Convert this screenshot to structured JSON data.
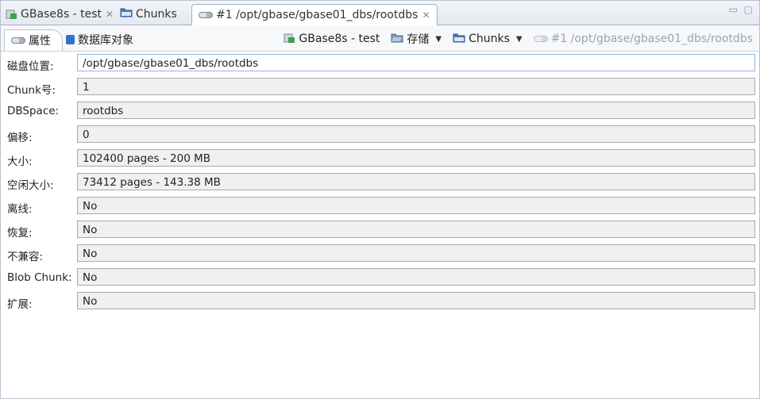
{
  "editor_tabs": [
    {
      "label": "GBase8s - test",
      "closable": true,
      "icon": "database-icon"
    },
    {
      "label": "Chunks",
      "closable": false,
      "icon": "folder-icon"
    },
    {
      "label": "#1 /opt/gbase/gbase01_dbs/rootdbs",
      "closable": true,
      "icon": "chunk-icon",
      "active": true
    }
  ],
  "window_controls": "▭ ▢",
  "sub_tabs": [
    {
      "label": "属性",
      "icon": "chunk-icon",
      "active": true
    },
    {
      "label": "数据库对象",
      "icon": "cube-icon"
    }
  ],
  "breadcrumb": [
    {
      "label": "GBase8s - test",
      "icon": "database-icon"
    },
    {
      "label": "存储",
      "icon": "storage-icon",
      "dropdown": true
    },
    {
      "label": "Chunks",
      "icon": "folder-icon",
      "dropdown": true
    },
    {
      "label": "#1 /opt/gbase/gbase01_dbs/rootdbs",
      "icon": "chunk-icon",
      "dim": true
    }
  ],
  "properties": [
    {
      "label": "磁盘位置:",
      "value": "/opt/gbase/gbase01_dbs/rootdbs"
    },
    {
      "label": "Chunk号:",
      "value": "1"
    },
    {
      "label": "DBSpace:",
      "value": "rootdbs"
    },
    {
      "label": "偏移:",
      "value": "0"
    },
    {
      "label": "大小:",
      "value": "102400 pages - 200 MB"
    },
    {
      "label": "空闲大小:",
      "value": "73412 pages - 143.38 MB"
    },
    {
      "label": "离线:",
      "value": "No"
    },
    {
      "label": "恢复:",
      "value": "No"
    },
    {
      "label": "不兼容:",
      "value": "No"
    },
    {
      "label": "Blob Chunk:",
      "value": "No"
    },
    {
      "label": "扩展:",
      "value": "No"
    }
  ],
  "colors": {
    "accent": "#2e74c9",
    "field_bg": "#f0f0f0",
    "db_green": "#3fa34d"
  }
}
